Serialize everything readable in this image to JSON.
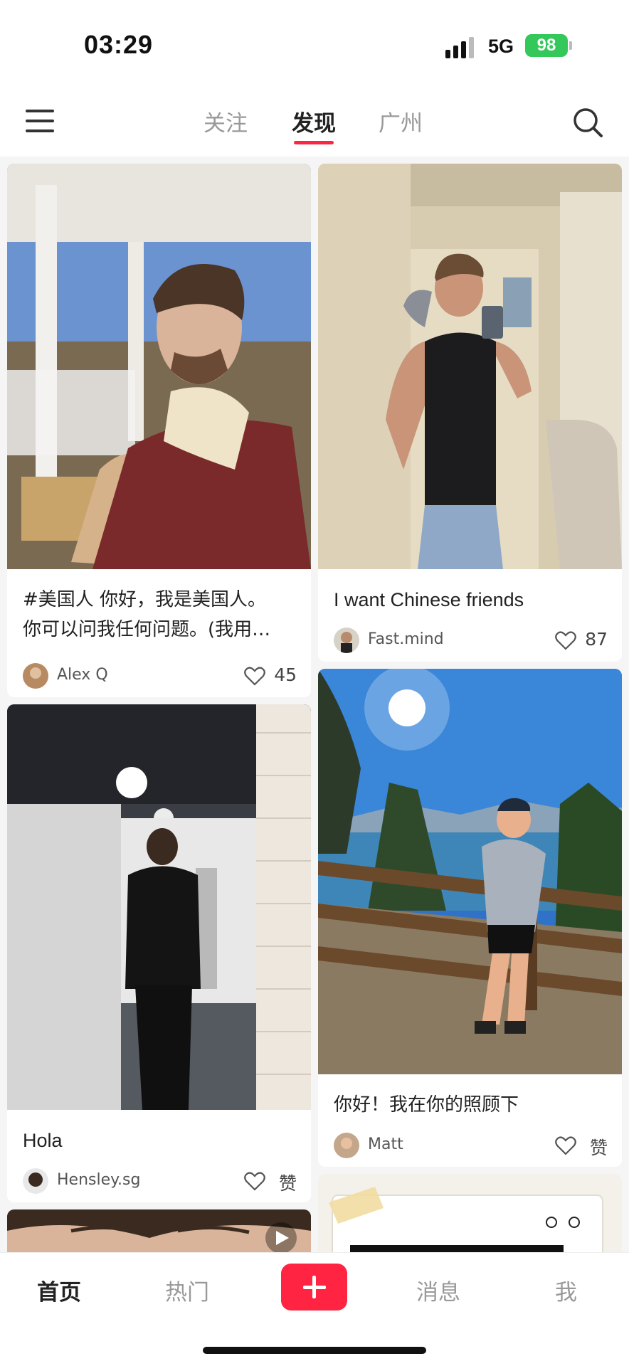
{
  "status_bar": {
    "time": "03:29",
    "network": "5G",
    "battery": "98"
  },
  "header": {
    "tabs": [
      {
        "label": "关注"
      },
      {
        "label": "发现"
      },
      {
        "label": "广州"
      }
    ],
    "active_tab": "发现"
  },
  "feed": {
    "cards": [
      {
        "title_line1": "#美国人 你好，我是美国人。",
        "title_line2": "你可以问我任何问题。(我用…",
        "author": "Alex Q",
        "likes": "45"
      },
      {
        "title": "I want Chinese friends",
        "author": "Fast.mind",
        "likes": "87"
      },
      {
        "title": "Hola",
        "author": "Hensley.sg",
        "likes": "赞"
      },
      {
        "title": "你好！我在你的照顾下",
        "author": "Matt",
        "likes": "赞"
      }
    ]
  },
  "bottom_nav": {
    "items": [
      {
        "label": "首页"
      },
      {
        "label": "热门"
      },
      {
        "label": "消息"
      },
      {
        "label": "我"
      }
    ],
    "active": "首页"
  },
  "colors": {
    "accent": "#ff2442",
    "battery": "#34c759"
  }
}
